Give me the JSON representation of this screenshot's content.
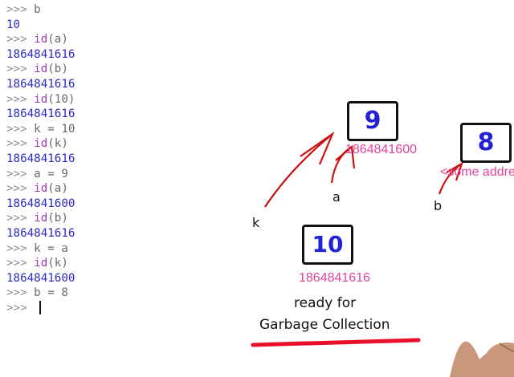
{
  "shell": {
    "prompt": ">>>",
    "lines": [
      {
        "type": "in",
        "cmd": "b"
      },
      {
        "type": "out",
        "text": "10"
      },
      {
        "type": "in",
        "fn": "id",
        "arg": "(a)"
      },
      {
        "type": "out",
        "text": "1864841616"
      },
      {
        "type": "in",
        "fn": "id",
        "arg": "(b)"
      },
      {
        "type": "out",
        "text": "1864841616"
      },
      {
        "type": "in",
        "fn": "id",
        "arg": "(10)"
      },
      {
        "type": "out",
        "text": "1864841616"
      },
      {
        "type": "in",
        "cmd": "k = 10"
      },
      {
        "type": "in",
        "fn": "id",
        "arg": "(k)"
      },
      {
        "type": "out",
        "text": "1864841616"
      },
      {
        "type": "in",
        "cmd": "a = 9"
      },
      {
        "type": "in",
        "fn": "id",
        "arg": "(a)"
      },
      {
        "type": "out",
        "text": "1864841600"
      },
      {
        "type": "in",
        "fn": "id",
        "arg": "(b)"
      },
      {
        "type": "out",
        "text": "1864841616"
      },
      {
        "type": "in",
        "cmd": "k = a"
      },
      {
        "type": "in",
        "fn": "id",
        "arg": "(k)"
      },
      {
        "type": "out",
        "text": "1864841600"
      },
      {
        "type": "in",
        "cmd": "b = 8"
      },
      {
        "type": "in",
        "cmd": ""
      }
    ]
  },
  "diagram": {
    "box_9": {
      "value": "9",
      "address": "1864841600"
    },
    "box_8": {
      "value": "8",
      "address": "<some address"
    },
    "box_10": {
      "value": "10",
      "address": "1864841616"
    },
    "labels": {
      "k": "k",
      "a": "a",
      "b": "b"
    },
    "note_line1": "ready for",
    "note_line2": "Garbage Collection",
    "colors": {
      "ink": "#cc1010",
      "underline": "#e8102a",
      "address": "#e0439c",
      "value": "#2222d4"
    }
  }
}
